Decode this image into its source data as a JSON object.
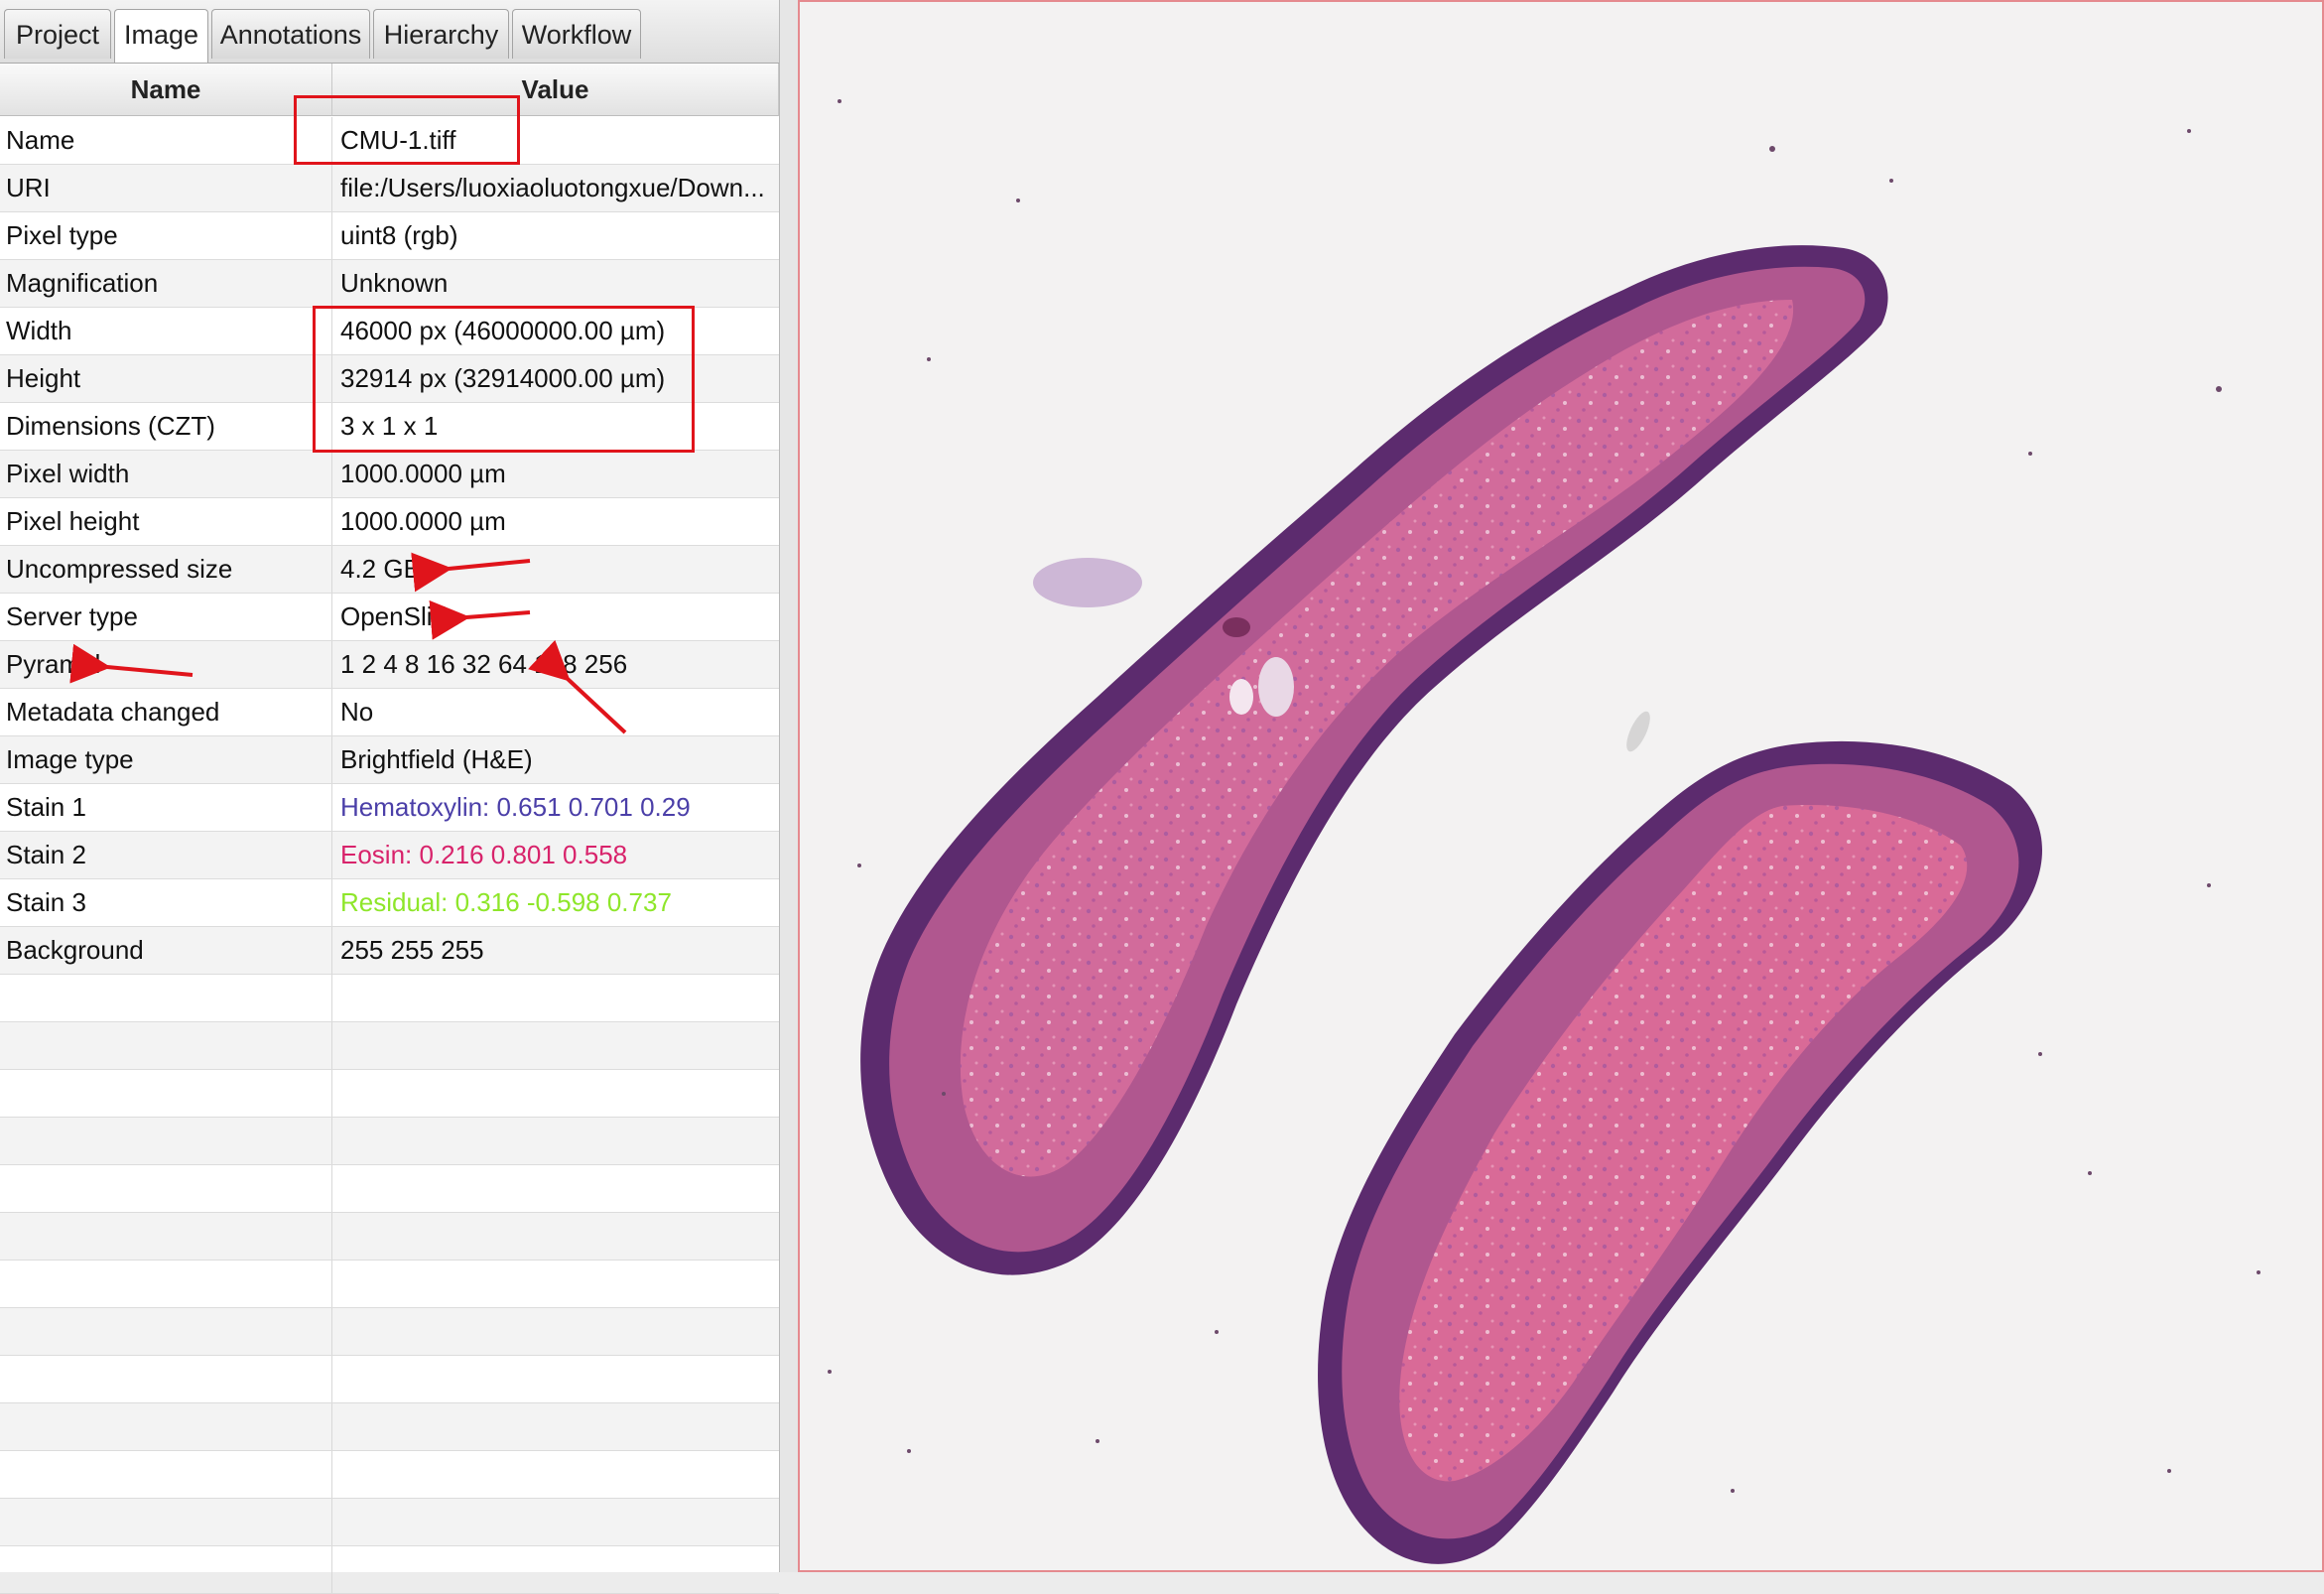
{
  "tabs": [
    {
      "label": "Project",
      "active": false
    },
    {
      "label": "Image",
      "active": true
    },
    {
      "label": "Annotations",
      "active": false
    },
    {
      "label": "Hierarchy",
      "active": false
    },
    {
      "label": "Workflow",
      "active": false
    }
  ],
  "table": {
    "columns": [
      "Name",
      "Value"
    ],
    "rows": [
      {
        "name": "Name",
        "value": "CMU-1.tiff"
      },
      {
        "name": "URI",
        "value": "file:/Users/luoxiaoluotongxue/Down..."
      },
      {
        "name": "Pixel type",
        "value": "uint8 (rgb)"
      },
      {
        "name": "Magnification",
        "value": "Unknown"
      },
      {
        "name": "Width",
        "value": "46000 px (46000000.00 µm)"
      },
      {
        "name": "Height",
        "value": "32914 px (32914000.00 µm)"
      },
      {
        "name": "Dimensions (CZT)",
        "value": "3 x 1 x 1"
      },
      {
        "name": "Pixel width",
        "value": "1000.0000 µm"
      },
      {
        "name": "Pixel height",
        "value": "1000.0000 µm"
      },
      {
        "name": "Uncompressed size",
        "value": "4.2 GB"
      },
      {
        "name": "Server type",
        "value": "OpenSlide"
      },
      {
        "name": "Pyramid",
        "value": "1 2 4 8 16 32 64 128 256"
      },
      {
        "name": "Metadata changed",
        "value": "No"
      },
      {
        "name": "Image type",
        "value": "Brightfield (H&E)"
      },
      {
        "name": "Stain 1",
        "value": "Hematoxylin: 0.651 0.701 0.29"
      },
      {
        "name": "Stain 2",
        "value": "Eosin: 0.216 0.801 0.558"
      },
      {
        "name": "Stain 3",
        "value": "Residual: 0.316 -0.598 0.737"
      },
      {
        "name": "Background",
        "value": "255 255 255"
      }
    ],
    "empty_row_count": 13
  },
  "colors": {
    "stain1": "#4b3fa8",
    "stain2": "#d8236b",
    "stain3": "#8ee62a",
    "annotation": "#e0141b",
    "tissue_edge": "#5c2b6e",
    "tissue_fill": "#b0578f",
    "tissue_pink": "#e56a95"
  }
}
